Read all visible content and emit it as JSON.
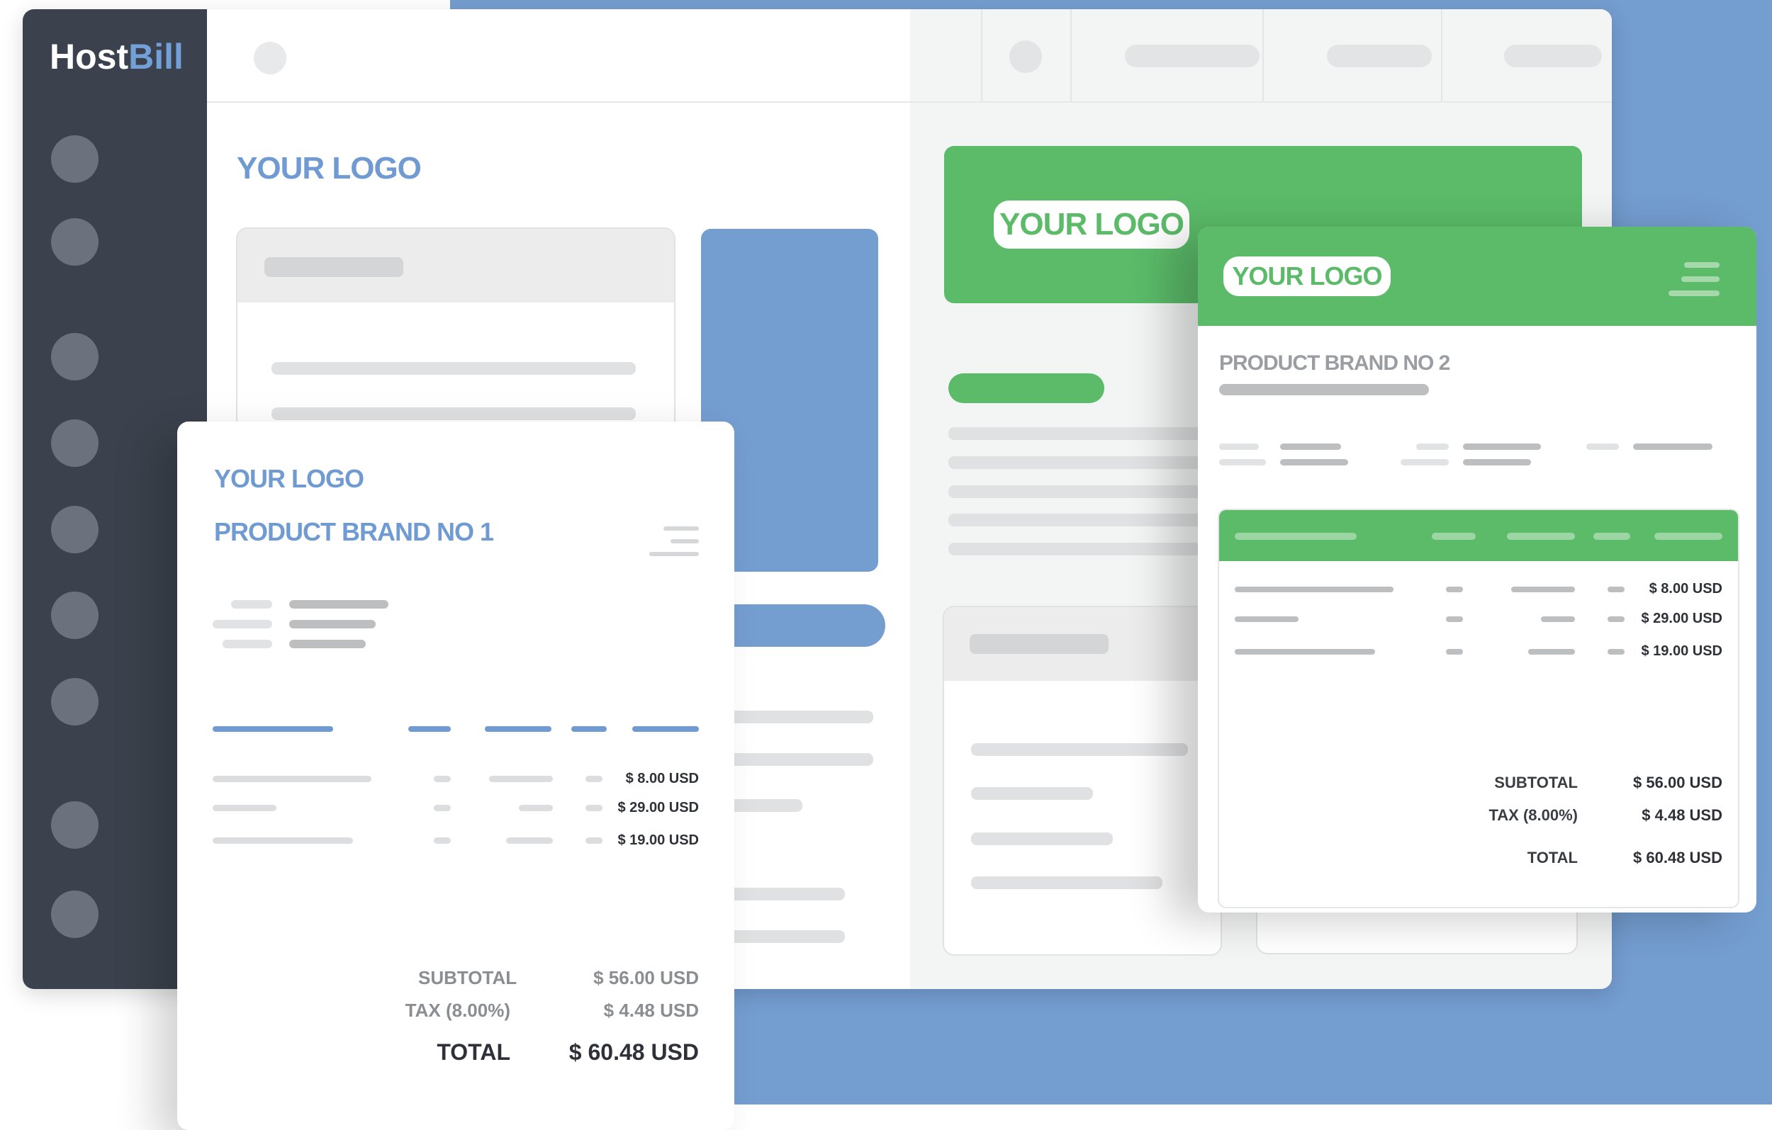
{
  "app": {
    "brand_host": "Host",
    "brand_bill": "Bill"
  },
  "main": {
    "logo_text": "YOUR LOGO",
    "green_logo_text": "YOUR LOGO"
  },
  "invoice1": {
    "logo": "YOUR LOGO",
    "brand": "PRODUCT BRAND NO 1",
    "line_amounts": [
      "$ 8.00 USD",
      "$ 29.00 USD",
      "$ 19.00 USD"
    ],
    "subtotal_label": "SUBTOTAL",
    "subtotal_value": "$ 56.00 USD",
    "tax_label": "TAX (8.00%)",
    "tax_value": "$ 4.48 USD",
    "total_label": "TOTAL",
    "total_value": "$ 60.48 USD"
  },
  "invoice2": {
    "logo": "YOUR LOGO",
    "brand": "PRODUCT BRAND NO 2",
    "line_amounts": [
      "$ 8.00 USD",
      "$ 29.00 USD",
      "$ 19.00 USD"
    ],
    "subtotal_label": "SUBTOTAL",
    "subtotal_value": "$ 56.00 USD",
    "tax_label": "TAX (8.00%)",
    "tax_value": "$ 4.48 USD",
    "total_label": "TOTAL",
    "total_value": "$ 60.48 USD"
  },
  "colors": {
    "accent_blue": "#749dd0",
    "brand_green": "#5bbb69",
    "sidebar": "#3b424d"
  }
}
